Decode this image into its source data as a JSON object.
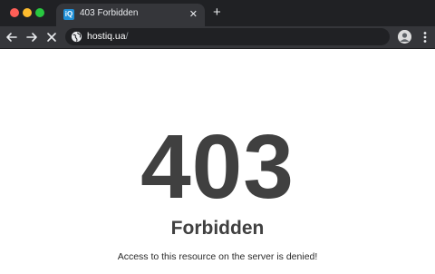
{
  "window": {
    "controls": [
      "close",
      "minimize",
      "maximize"
    ]
  },
  "tab": {
    "favicon_text": "iQ",
    "title": "403 Forbidden",
    "close_icon": "close-icon",
    "new_tab_icon": "plus-icon"
  },
  "toolbar": {
    "back_icon": "back-arrow-icon",
    "forward_icon": "forward-arrow-icon",
    "stop_icon": "stop-loading-icon",
    "url_host": "hostiq.ua",
    "url_path": "/",
    "avatar_icon": "profile-avatar-icon",
    "menu_icon": "kebab-menu-icon"
  },
  "page": {
    "code": "403",
    "heading": "Forbidden",
    "message": "Access to this resource on the server is denied!"
  },
  "colors": {
    "tabstrip_bg": "#202124",
    "toolbar_bg": "#35363a",
    "text_dark": "#404040"
  }
}
